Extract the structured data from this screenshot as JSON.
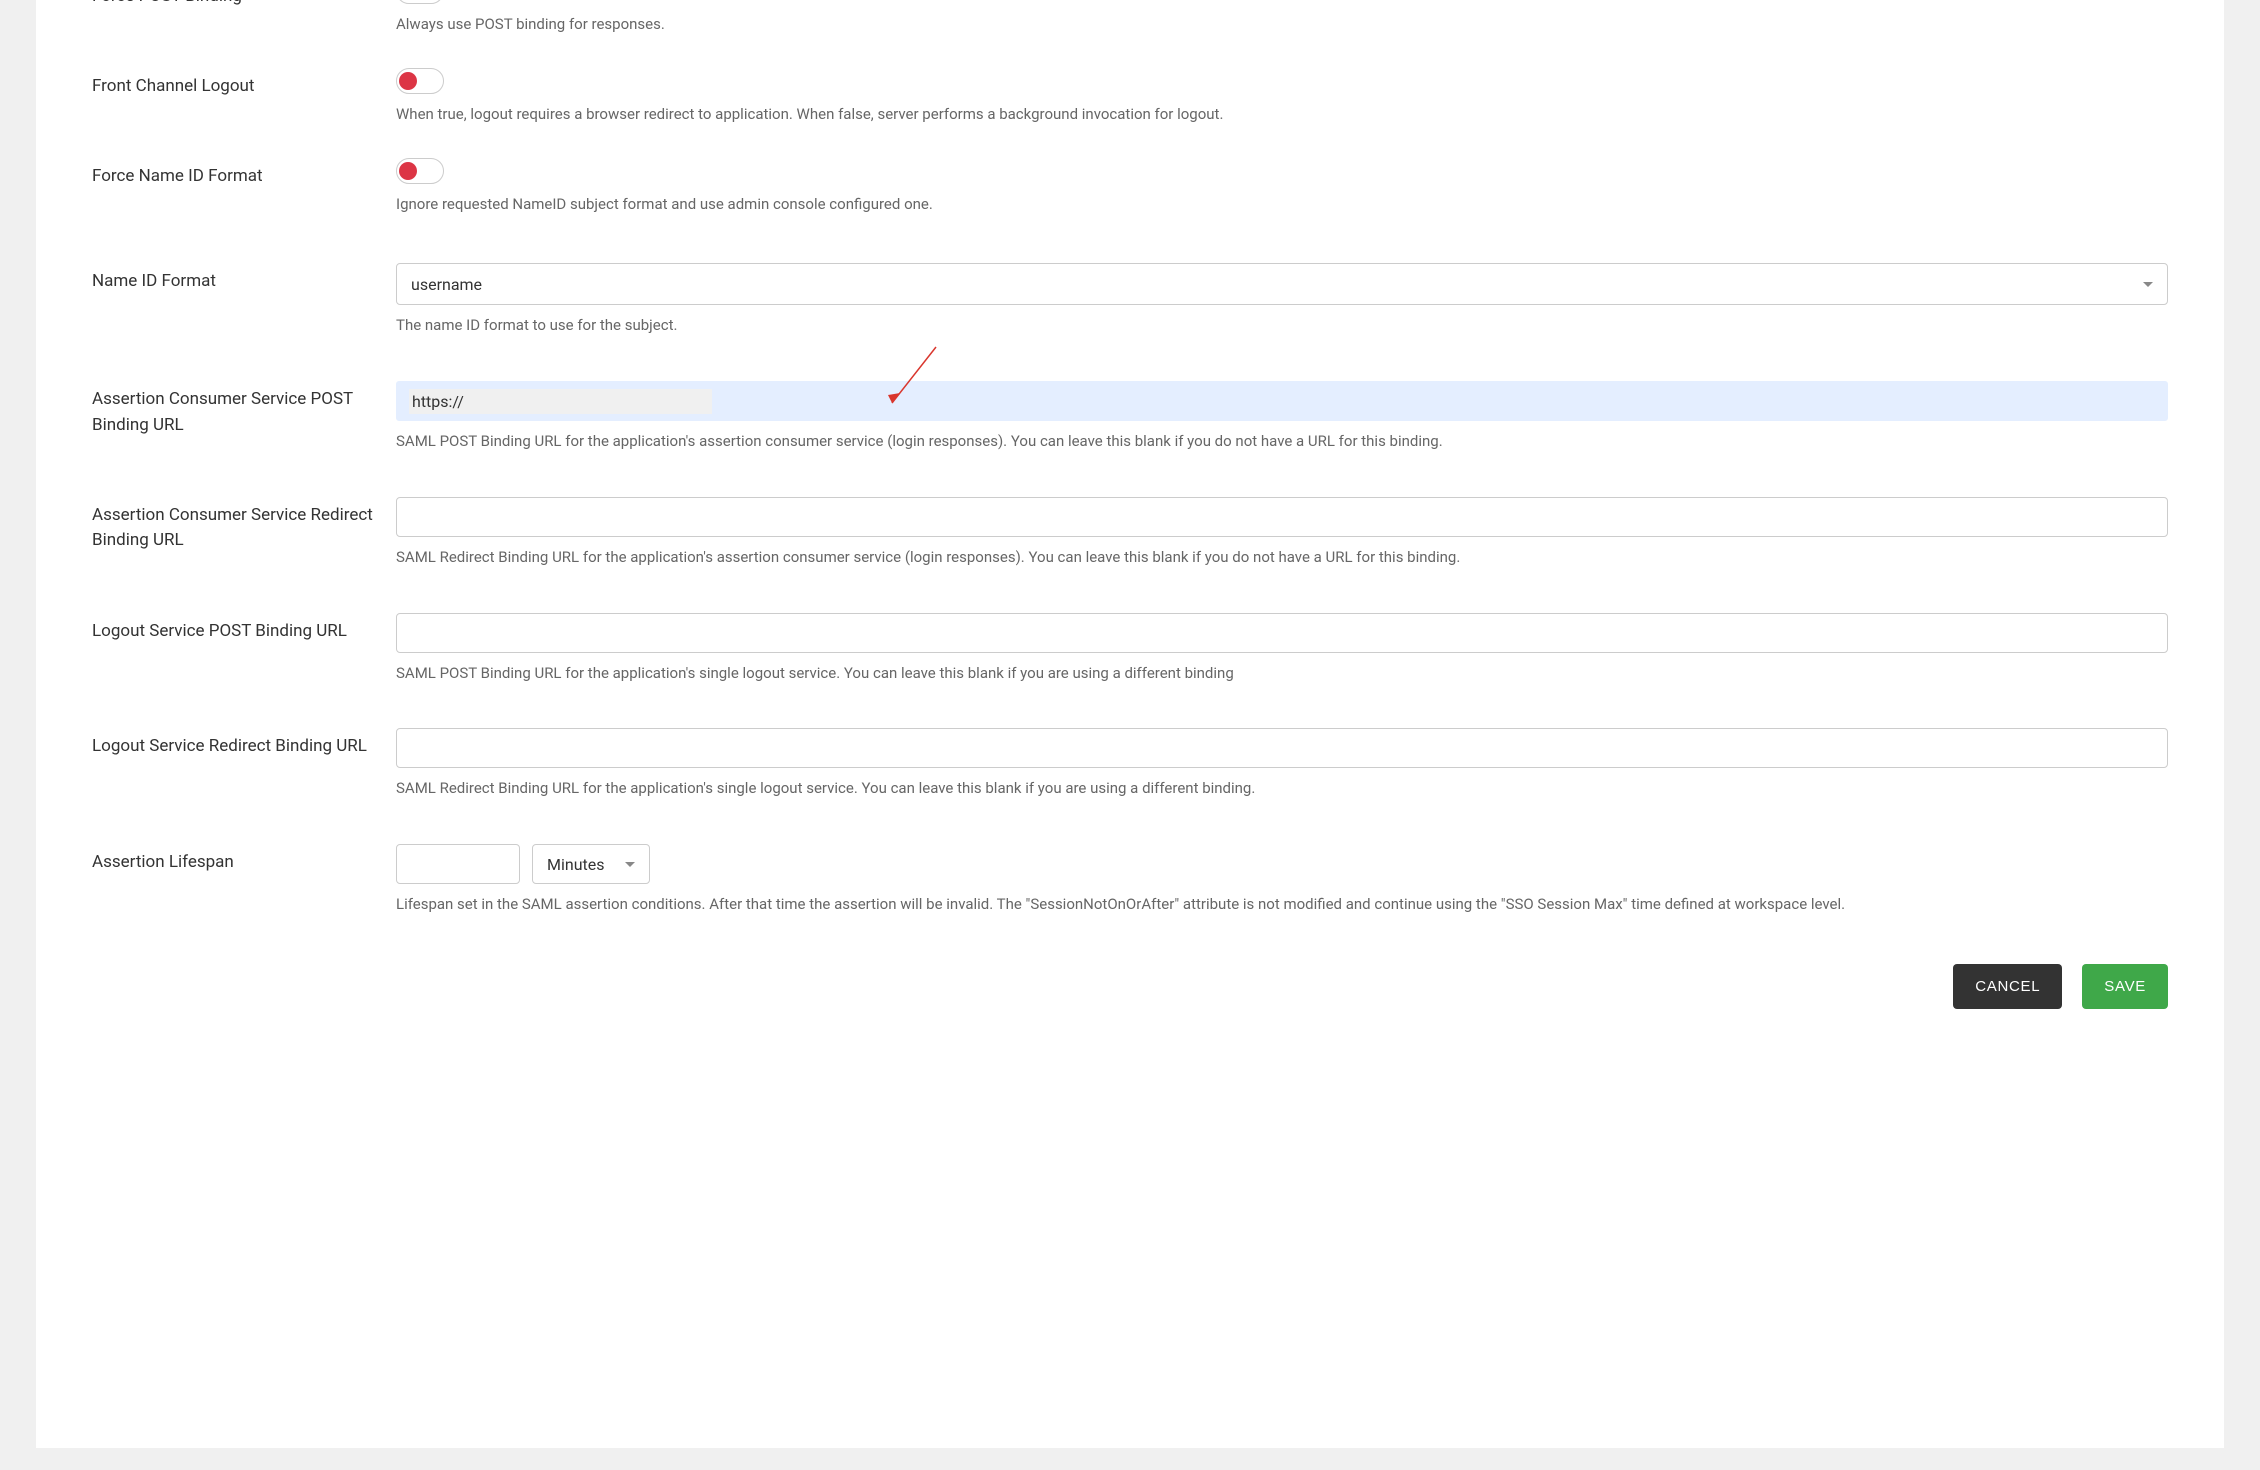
{
  "fields": {
    "force_post_binding": {
      "label": "Force POST Binding",
      "help": "Always use POST binding for responses."
    },
    "front_channel_logout": {
      "label": "Front Channel Logout",
      "help": "When true, logout requires a browser redirect to application. When false, server performs a background invocation for logout."
    },
    "force_nameid_format": {
      "label": "Force Name ID Format",
      "help": "Ignore requested NameID subject format and use admin console configured one."
    },
    "nameid_format": {
      "label": "Name ID Format",
      "value": "username",
      "help": "The name ID format to use for the subject."
    },
    "acs_post": {
      "label": "Assertion Consumer Service POST Binding URL",
      "value": "https://",
      "help": "SAML POST Binding URL for the application's assertion consumer service (login responses). You can leave this blank if you do not have a URL for this binding."
    },
    "acs_redirect": {
      "label": "Assertion Consumer Service Redirect Binding URL",
      "value": "",
      "help": "SAML Redirect Binding URL for the application's assertion consumer service (login responses). You can leave this blank if you do not have a URL for this binding."
    },
    "logout_post": {
      "label": "Logout Service POST Binding URL",
      "value": "",
      "help": "SAML POST Binding URL for the application's single logout service. You can leave this blank if you are using a different binding"
    },
    "logout_redirect": {
      "label": "Logout Service Redirect Binding URL",
      "value": "",
      "help": "SAML Redirect Binding URL for the application's single logout service. You can leave this blank if you are using a different binding."
    },
    "assertion_lifespan": {
      "label": "Assertion Lifespan",
      "value": "",
      "unit": "Minutes",
      "help": "Lifespan set in the SAML assertion conditions. After that time the assertion will be invalid. The \"SessionNotOnOrAfter\" attribute is not modified and continue using the \"SSO Session Max\" time defined at workspace level."
    }
  },
  "buttons": {
    "cancel": "CANCEL",
    "save": "SAVE"
  }
}
